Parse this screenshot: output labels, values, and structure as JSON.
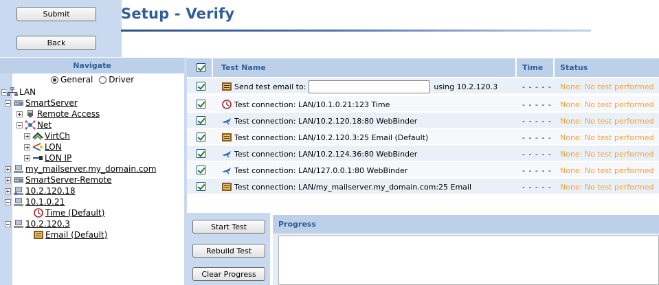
{
  "buttons": {
    "submit": "Submit",
    "back": "Back"
  },
  "title": "Setup - Verify",
  "navigate": {
    "header": "Navigate",
    "radio": {
      "general": "General",
      "driver": "Driver",
      "selected": "General"
    },
    "tree": [
      {
        "label": "LAN",
        "icon": "lan-network-icon"
      },
      {
        "label": "SmartServer",
        "icon": "server-icon"
      },
      {
        "label": "Remote Access",
        "icon": "remote-access-icon"
      },
      {
        "label": "Net",
        "icon": "net-icon"
      },
      {
        "label": "VirtCh",
        "icon": "virtual-channel-icon"
      },
      {
        "label": "LON",
        "icon": "lon-icon"
      },
      {
        "label": "LON IP",
        "icon": "lon-ip-icon"
      },
      {
        "label": "my_mailserver.my_domain.com",
        "icon": "computer-icon"
      },
      {
        "label": "SmartServer-Remote",
        "icon": "server-icon"
      },
      {
        "label": "10.2.120.18",
        "icon": "computer-icon"
      },
      {
        "label": "10.1.0.21",
        "icon": "computer-icon"
      },
      {
        "label": "Time (Default)",
        "icon": "clock-icon"
      },
      {
        "label": "10.2.120.3",
        "icon": "computer-icon"
      },
      {
        "label": "Email (Default)",
        "icon": "email-icon"
      }
    ]
  },
  "table": {
    "headers": {
      "name": "Test Name",
      "time": "Time",
      "status": "Status"
    },
    "rows": [
      {
        "type": "email-input",
        "prefix": "Send test email to:",
        "input_value": "",
        "suffix": "using 10.2.120.3",
        "time": "- - - - -",
        "status": "None: No test performed",
        "icon": "email-icon"
      },
      {
        "name": "Test connection: LAN/10.1.0.21:123 Time",
        "time": "- - - - -",
        "status": "None: No test performed",
        "icon": "clock-icon"
      },
      {
        "name": "Test connection: LAN/10.2.120.18:80 WebBinder",
        "time": "- - - - -",
        "status": "None: No test performed",
        "icon": "webbinder-icon"
      },
      {
        "name": "Test connection: LAN/10.2.120.3:25 Email (Default)",
        "time": "- - - - -",
        "status": "None: No test performed",
        "icon": "email-icon"
      },
      {
        "name": "Test connection: LAN/10.2.124.36:80 WebBinder",
        "time": "- - - - -",
        "status": "None: No test performed",
        "icon": "webbinder-icon"
      },
      {
        "name": "Test connection: LAN/127.0.0.1:80 WebBinder",
        "time": "- - - - -",
        "status": "None: No test performed",
        "icon": "webbinder-icon"
      },
      {
        "name": "Test connection: LAN/my_mailserver.my_domain.com:25 Email",
        "time": "- - - - -",
        "status": "None: No test performed",
        "icon": "email-icon"
      }
    ]
  },
  "actions": {
    "start": "Start Test",
    "rebuild": "Rebuild Test",
    "clear": "Clear Progress"
  },
  "progress": {
    "header": "Progress",
    "content": ""
  },
  "colors": {
    "title": "#2f5e97",
    "panel": "#c9daf0",
    "header": "#bdd0ea",
    "status": "#f0a23c"
  }
}
